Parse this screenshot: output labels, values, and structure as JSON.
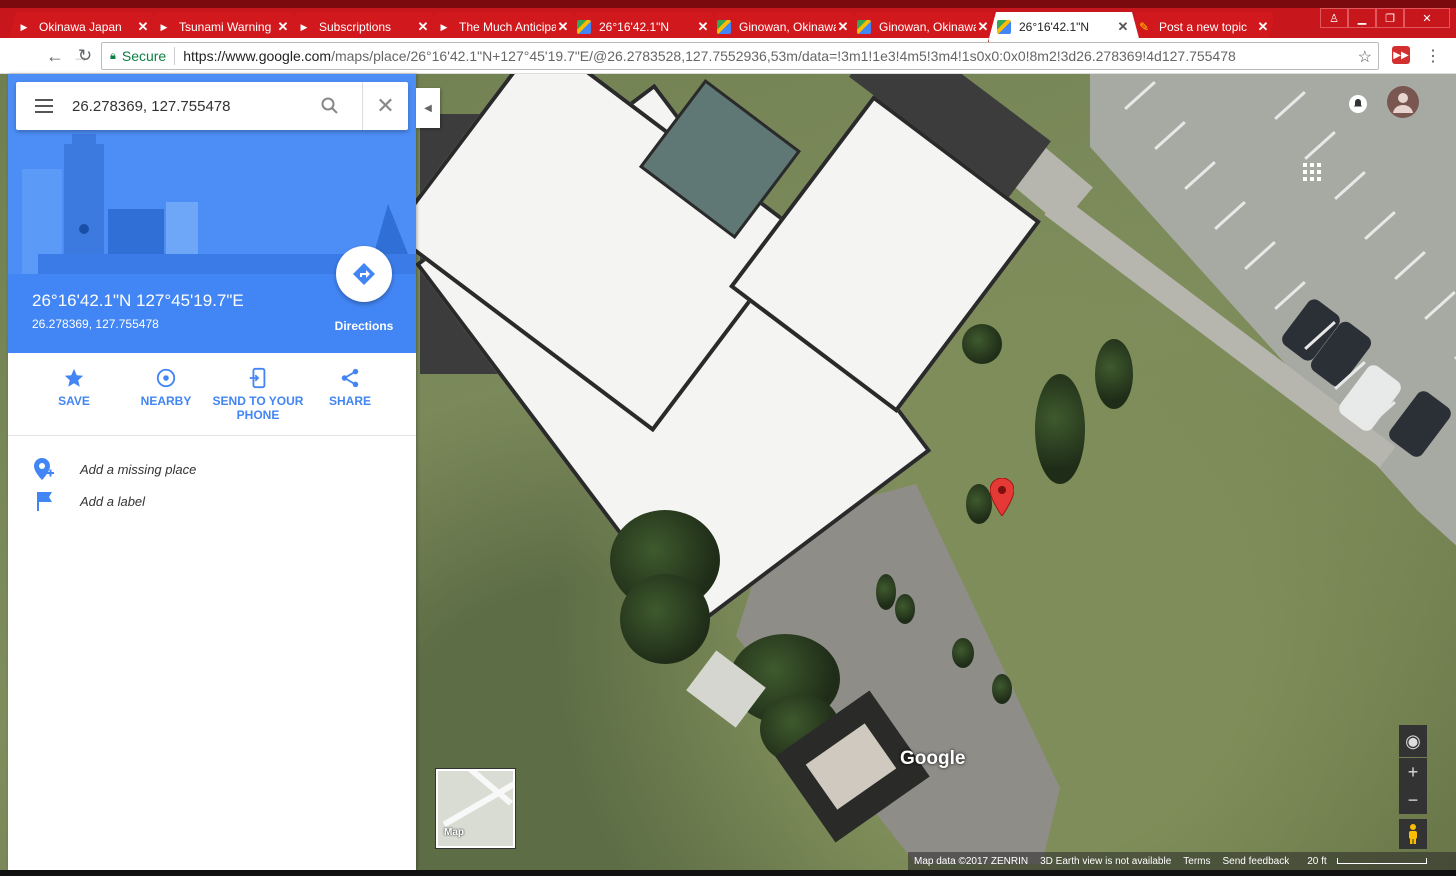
{
  "browser": {
    "tabs": [
      {
        "title": "Okinawa Japan",
        "favicon": "youtube-icon",
        "active": false
      },
      {
        "title": "Tsunami Warning",
        "favicon": "youtube-icon",
        "active": false
      },
      {
        "title": "Subscriptions",
        "favicon": "youtube-icon",
        "active": false
      },
      {
        "title": "The Much Anticipated",
        "favicon": "youtube-icon",
        "active": false
      },
      {
        "title": "26°16'42.1\"N",
        "favicon": "maps-icon",
        "active": false
      },
      {
        "title": "Ginowan, Okinawa",
        "favicon": "maps-icon",
        "active": false
      },
      {
        "title": "Ginowan, Okinawa",
        "favicon": "maps-icon",
        "active": false
      },
      {
        "title": "26°16'42.1\"N",
        "favicon": "maps-icon",
        "active": true
      },
      {
        "title": "Post a new topic",
        "favicon": "pencil-icon",
        "active": false
      }
    ],
    "secure_label": "Secure",
    "url_host": "https://www.google.com",
    "url_path": "/maps/place/26°16'42.1\"N+127°45'19.7\"E/@26.2783528,127.7552936,53m/data=!3m1!1e3!4m5!3m4!1s0x0:0x0!8m2!3d26.278369!4d127.755478"
  },
  "panel": {
    "search_value": "26.278369, 127.755478",
    "coord_title": "26°16'42.1\"N 127°45'19.7\"E",
    "coord_sub": "26.278369, 127.755478",
    "directions_label": "Directions",
    "actions": [
      {
        "label": "SAVE",
        "icon": "star-icon"
      },
      {
        "label": "NEARBY",
        "icon": "nearby-icon"
      },
      {
        "label": "SEND TO YOUR PHONE",
        "icon": "send-to-phone-icon"
      },
      {
        "label": "SHARE",
        "icon": "share-icon"
      }
    ],
    "add_missing_place": "Add a missing place",
    "add_label": "Add a label",
    "accent_color": "#4285f4"
  },
  "map": {
    "logo": "Google",
    "minimap_label": "Map",
    "footer": {
      "map_data": "Map data ©2017 ZENRIN",
      "earth_view": "3D Earth view is not available",
      "terms": "Terms",
      "send_feedback": "Send feedback",
      "scale": "20 ft"
    }
  }
}
